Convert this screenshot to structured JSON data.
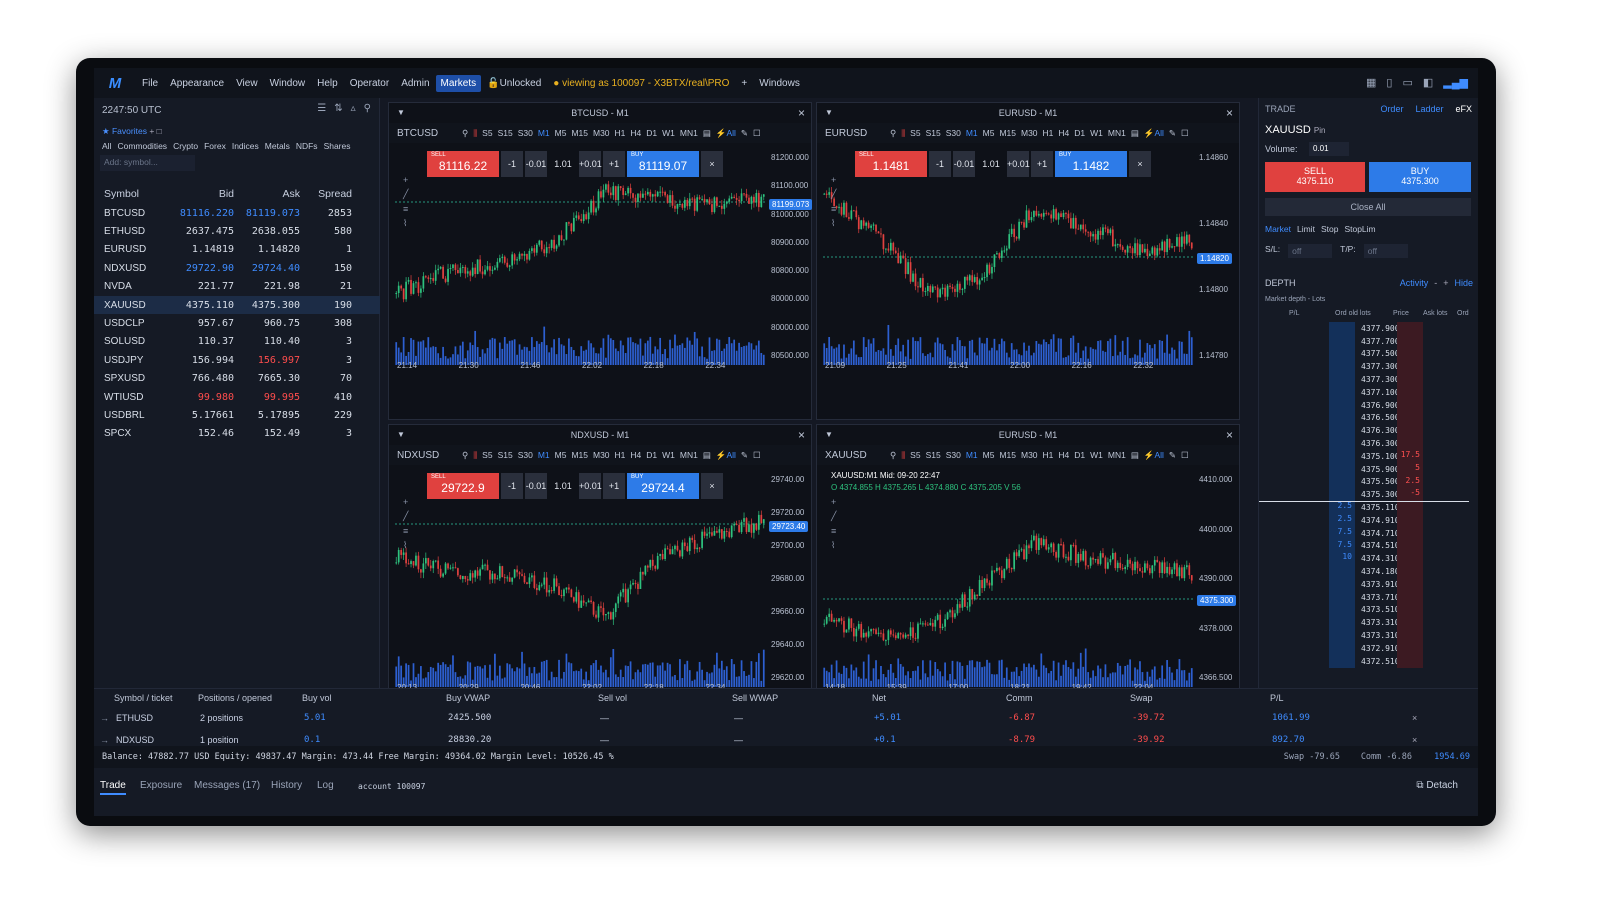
{
  "menu": {
    "logo": "M",
    "items": [
      "File",
      "Appearance",
      "View",
      "Window",
      "Help",
      "Operator",
      "Admin",
      "Markets"
    ],
    "active": "Markets",
    "unlocked": "Unlocked",
    "viewing": "viewing as 100097 - X3BTX/real\\PRO",
    "windows": "Windows"
  },
  "watchlist": {
    "clock": "2247:50 UTC",
    "favorites": "Favorites",
    "categories": [
      "All",
      "Commodities",
      "Crypto",
      "Forex",
      "Indices",
      "Metals",
      "NDFs",
      "Shares"
    ],
    "add_placeholder": "Add: symbol...",
    "headers": [
      "Symbol",
      "Bid",
      "Ask",
      "Spread"
    ],
    "rows": [
      {
        "sym": "BTCUSD",
        "bid": "81116.220",
        "ask": "81119.073",
        "spread": "2853",
        "bid_color": "blue",
        "ask_color": "blue"
      },
      {
        "sym": "ETHUSD",
        "bid": "2637.475",
        "ask": "2638.055",
        "spread": "580"
      },
      {
        "sym": "EURUSD",
        "bid": "1.14819",
        "ask": "1.14820",
        "spread": "1"
      },
      {
        "sym": "NDXUSD",
        "bid": "29722.90",
        "ask": "29724.40",
        "spread": "150",
        "bid_color": "blue",
        "ask_color": "blue"
      },
      {
        "sym": "NVDA",
        "bid": "221.77",
        "ask": "221.98",
        "spread": "21"
      },
      {
        "sym": "XAUUSD",
        "bid": "4375.110",
        "ask": "4375.300",
        "spread": "190",
        "selected": true
      },
      {
        "sym": "USDCLP",
        "bid": "957.67",
        "ask": "960.75",
        "spread": "308"
      },
      {
        "sym": "SOLUSD",
        "bid": "110.37",
        "ask": "110.40",
        "spread": "3"
      },
      {
        "sym": "USDJPY",
        "bid": "156.994",
        "ask": "156.997",
        "spread": "3",
        "ask_color": "red"
      },
      {
        "sym": "SPXUSD",
        "bid": "766.480",
        "ask": "7665.30",
        "spread": "70"
      },
      {
        "sym": "WTIUSD",
        "bid": "99.980",
        "ask": "99.995",
        "spread": "410",
        "bid_color": "red",
        "ask_color": "red"
      },
      {
        "sym": "USDBRL",
        "bid": "5.17661",
        "ask": "5.17895",
        "spread": "229"
      },
      {
        "sym": "SPCX",
        "bid": "152.46",
        "ask": "152.49",
        "spread": "3"
      }
    ]
  },
  "timeframes": [
    "S5",
    "S15",
    "S30",
    "M1",
    "M5",
    "M15",
    "M30",
    "H1",
    "H4",
    "D1",
    "W1",
    "MN1"
  ],
  "charts": [
    {
      "title": "BTCUSD - M1",
      "symbol": "BTCUSD",
      "sell": "81116.22",
      "buy": "81119.07",
      "tag": "81199.073",
      "prices": [
        "81200.000",
        "81100.000",
        "81000.000",
        "80900.000",
        "80800.000",
        "80000.000",
        "80000.000",
        "80500.000"
      ],
      "times": [
        "21:14",
        "21:30",
        "21:46",
        "22:02",
        "22:18",
        "22:34"
      ],
      "seed": 1,
      "trend": [
        0.2,
        0.35,
        0.4,
        0.55,
        0.9,
        0.85,
        0.8,
        0.85
      ]
    },
    {
      "title": "EURUSD - M1",
      "symbol": "EURUSD",
      "sell": "1.1481",
      "buy": "1.1482",
      "tag": "1.14820",
      "prices": [
        "1.14860",
        "1.14840",
        "1.14800",
        "1.14780"
      ],
      "times": [
        "21:09",
        "21:25",
        "21:41",
        "22:00",
        "22:16",
        "22:32"
      ],
      "seed": 2,
      "trend": [
        0.9,
        0.6,
        0.2,
        0.3,
        0.8,
        0.65,
        0.5,
        0.55
      ]
    },
    {
      "title": "NDXUSD - M1",
      "symbol": "NDXUSD",
      "sell": "29722.9",
      "buy": "29724.4",
      "tag": "29723.40",
      "prices": [
        "29740.00",
        "29720.00",
        "29700.00",
        "29680.00",
        "29660.00",
        "29640.00",
        "29620.00"
      ],
      "times": [
        "20:13",
        "20:29",
        "20:46",
        "22:02",
        "22:18",
        "22:34"
      ],
      "seed": 3,
      "trend": [
        0.6,
        0.5,
        0.5,
        0.4,
        0.2,
        0.6,
        0.75,
        0.85
      ]
    },
    {
      "title": "EURUSD - M1",
      "symbol": "XAUUSD",
      "ohlc": "XAUUSD:M1 Mid: 09-20 22:47",
      "ohlc_values": "O 4374.855  H 4375.265  L 4374.880  C 4375.205  V 56",
      "tag": "4375.300",
      "prices": [
        "4410.000",
        "4400.000",
        "4390.000",
        "4378.000",
        "4366.500"
      ],
      "times": [
        "14:18",
        "15:39",
        "17:00",
        "18:21",
        "19:42",
        "22:04"
      ],
      "seed": 4,
      "trend": [
        0.2,
        0.05,
        0.1,
        0.4,
        0.7,
        0.6,
        0.55,
        0.5
      ]
    }
  ],
  "trade": {
    "title": "TRADE",
    "tabs": [
      "Order",
      "Ladder",
      "eFX"
    ],
    "symbol": "XAUUSD",
    "pin": "Pin",
    "volume_label": "Volume:",
    "volume": "0.01",
    "sell_label": "SELL",
    "sell_price": "4375.110",
    "buy_label": "BUY",
    "buy_price": "4375.300",
    "close_all": "Close All",
    "order_types": [
      "Market",
      "Limit",
      "Stop",
      "StopLim"
    ],
    "sl_label": "S/L:",
    "sl": "off",
    "tp_label": "T/P:",
    "tp": "off"
  },
  "depth": {
    "title": "DEPTH",
    "activity": "Activity",
    "hide": "Hide",
    "subtitle": "Market depth - Lots",
    "cols": [
      "P/L",
      "Ord old lots",
      "Price",
      "Ask lots",
      "Ord"
    ],
    "rows": [
      {
        "p": "4377.900"
      },
      {
        "p": "4377.700"
      },
      {
        "p": "4377.500"
      },
      {
        "p": "4377.300"
      },
      {
        "p": "4377.300"
      },
      {
        "p": "4377.100"
      },
      {
        "p": "4376.900"
      },
      {
        "p": "4376.500"
      },
      {
        "p": "4376.300"
      },
      {
        "p": "4376.300"
      },
      {
        "p": "4375.100",
        "a": "17.5"
      },
      {
        "p": "4375.900",
        "a": "5"
      },
      {
        "p": "4375.500",
        "a": "2.5"
      },
      {
        "p": "4375.300",
        "a": "-5"
      },
      {
        "p": "4375.110",
        "b": "2.5"
      },
      {
        "p": "4374.910",
        "b": "2.5"
      },
      {
        "p": "4374.710",
        "b": "7.5"
      },
      {
        "p": "4374.510",
        "b": "7.5"
      },
      {
        "p": "4374.310",
        "b": "10"
      },
      {
        "p": "4374.180"
      },
      {
        "p": "4373.910"
      },
      {
        "p": "4373.710"
      },
      {
        "p": "4373.510"
      },
      {
        "p": "4373.310"
      },
      {
        "p": "4373.310"
      },
      {
        "p": "4372.910"
      },
      {
        "p": "4372.510"
      }
    ]
  },
  "positions": {
    "headers": [
      "Symbol / ticket",
      "Positions / opened",
      "Buy vol",
      "Buy VWAP",
      "Sell vol",
      "Sell WWAP",
      "Net",
      "Comm",
      "Swap",
      "P/L"
    ],
    "rows": [
      {
        "sym": "ETHUSD",
        "pos": "2 positions",
        "buyvol": "5.01",
        "vwap": "2425.500",
        "sellvol": "—",
        "swap_w": "—",
        "net": "+5.01",
        "comm": "-6.87",
        "swap": "-39.72",
        "pl": "1061.99"
      },
      {
        "sym": "NDXUSD",
        "pos": "1 position",
        "buyvol": "0.1",
        "vwap": "28830.20",
        "sellvol": "—",
        "swap_w": "—",
        "net": "+0.1",
        "comm": "-8.79",
        "swap": "-39.92",
        "pl": "892.70"
      }
    ]
  },
  "balance": {
    "text": "Balance: 47882.77 USD    Equity: 49837.47    Margin: 473.44    Free Margin: 49364.02    Margin Level: 10526.45 %",
    "swap": "Swap -79.65",
    "comm": "Comm -6.86",
    "pl": "1954.69"
  },
  "bottom_tabs": [
    "Trade",
    "Exposure",
    "Messages (17)",
    "History",
    "Log"
  ],
  "account": "account 100097",
  "detach": "Detach"
}
